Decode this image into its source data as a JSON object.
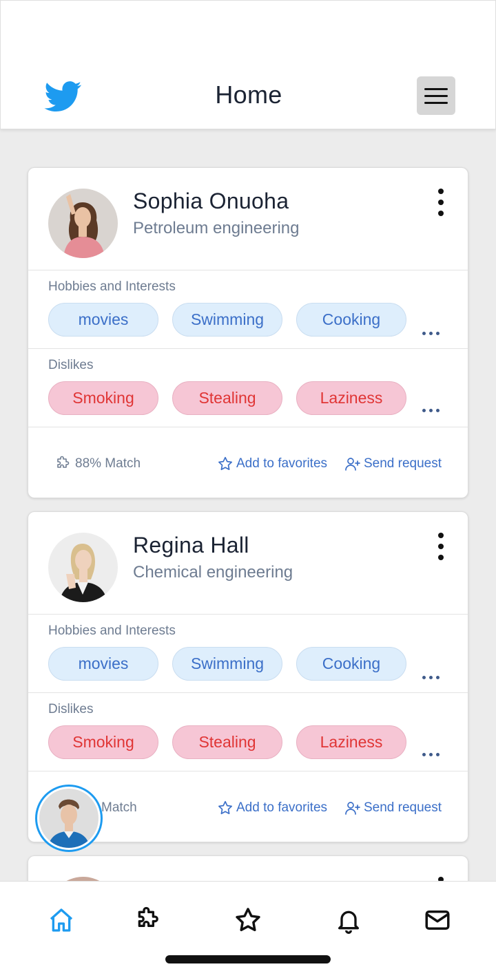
{
  "header": {
    "title": "Home",
    "logo_icon": "bird-logo-icon",
    "menu_icon": "hamburger-menu-icon",
    "brand_color": "#1d9bf0"
  },
  "profiles": [
    {
      "name": "Sophia Onuoha",
      "major": "Petroleum engineering",
      "hobbies_label": "Hobbies and Interests",
      "hobbies": [
        "movies",
        "Swimming",
        "Cooking"
      ],
      "dislikes_label": "Dislikes",
      "dislikes": [
        "Smoking",
        "Stealing",
        "Laziness"
      ],
      "match": "88% Match",
      "favorite_label": "Add to favorites",
      "request_label": "Send request"
    },
    {
      "name": "Regina Hall",
      "major": "Chemical engineering",
      "hobbies_label": "Hobbies and Interests",
      "hobbies": [
        "movies",
        "Swimming",
        "Cooking"
      ],
      "dislikes_label": "Dislikes",
      "dislikes": [
        "Smoking",
        "Stealing",
        "Laziness"
      ],
      "match": "Match",
      "favorite_label": "Add to favorites",
      "request_label": "Send request"
    }
  ],
  "nav": {
    "items": [
      "home-icon",
      "puzzle-icon",
      "star-icon",
      "bell-icon",
      "mail-icon"
    ],
    "active": "home-icon",
    "active_color": "#1d9bf0"
  }
}
